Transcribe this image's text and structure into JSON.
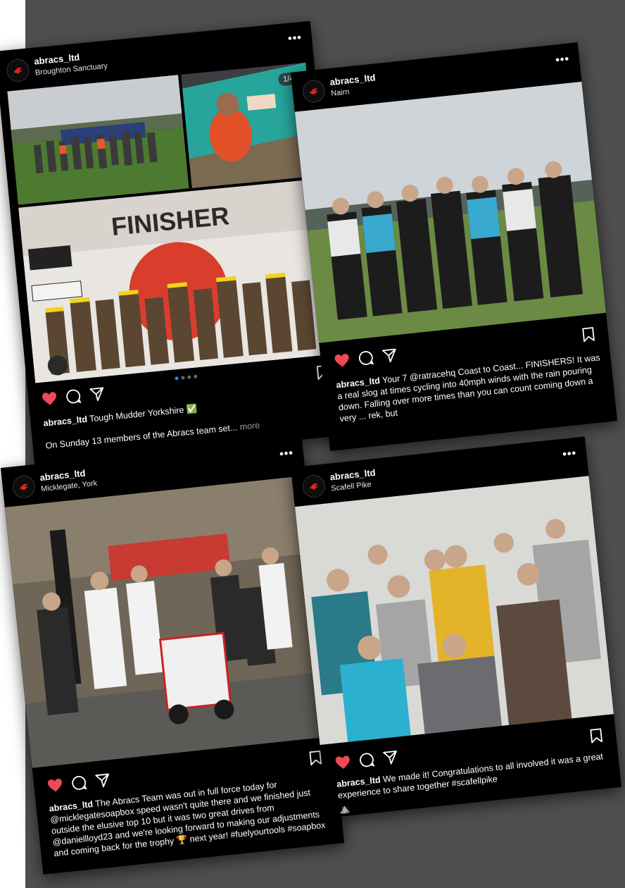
{
  "posts": [
    {
      "username": "abracs_ltd",
      "location": "Broughton Sanctuary",
      "counter": "1/4",
      "finisher_text": "FINISHER",
      "caption_user": "abracs_ltd",
      "caption_text": "Tough Mudder Yorkshire ✅",
      "caption_line2": "On Sunday 13 members of the Abracs team set...",
      "more": "more"
    },
    {
      "username": "abracs_ltd",
      "location": "Nairn",
      "caption_user": "abracs_ltd",
      "caption_text": "Your 7 @ratracehq Coast to Coast... FINISHERS! It was a real slog at times cycling into 40mph winds with the rain pouring down. Falling over more times than you can count coming down a very ... rek, but"
    },
    {
      "username": "abracs_ltd",
      "location": "Micklegate, York",
      "caption_user": "abracs_ltd",
      "caption_text": "The Abracs Team was out in full force today for @micklegatesoapbox speed wasn't quite there and we finished just outside the elusive top 10 but it was two great drives from @daniellloyd23 and we're looking forward to making our adjustments and coming back for the trophy 🏆 next year! #fuelyourtools #soapbox"
    },
    {
      "username": "abracs_ltd",
      "location": "Scafell Pike",
      "caption_user": "abracs_ltd",
      "caption_text": "We made it! Congratulations to all involved it was a great experience to share together #scafellpike",
      "caption_emoji": "⛰️"
    }
  ],
  "colors": {
    "background": "#4f4f4f",
    "card": "#000000",
    "heart": "#ed4956",
    "brand": "#e8231b",
    "carousel_active": "#1e90ff"
  },
  "icons": [
    "abracs-logo-icon",
    "heart-icon",
    "comment-icon",
    "share-icon",
    "bookmark-icon",
    "more-icon"
  ]
}
